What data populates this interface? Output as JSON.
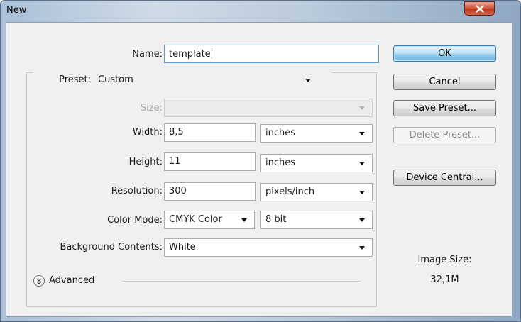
{
  "window": {
    "title": "New"
  },
  "form": {
    "name_label": "Name:",
    "name_value": "template",
    "preset_label": "Preset:",
    "preset_value": "Custom",
    "size_label": "Size:",
    "size_value": "",
    "width_label": "Width:",
    "width_value": "8,5",
    "width_unit": "inches",
    "height_label": "Height:",
    "height_value": "11",
    "height_unit": "inches",
    "resolution_label": "Resolution:",
    "resolution_value": "300",
    "resolution_unit": "pixels/inch",
    "color_mode_label": "Color Mode:",
    "color_mode_value": "CMYK Color",
    "bit_depth_value": "8 bit",
    "background_label": "Background Contents:",
    "background_value": "White",
    "advanced_label": "Advanced"
  },
  "buttons": {
    "ok": "OK",
    "cancel": "Cancel",
    "save_preset": "Save Preset...",
    "delete_preset": "Delete Preset...",
    "device_central": "Device Central..."
  },
  "info": {
    "image_size_label": "Image Size:",
    "image_size_value": "32,1M"
  },
  "colors": {
    "default_button": "#98d1ef",
    "close_button": "#c0371b",
    "dialog_background": "#f0f0f0"
  }
}
